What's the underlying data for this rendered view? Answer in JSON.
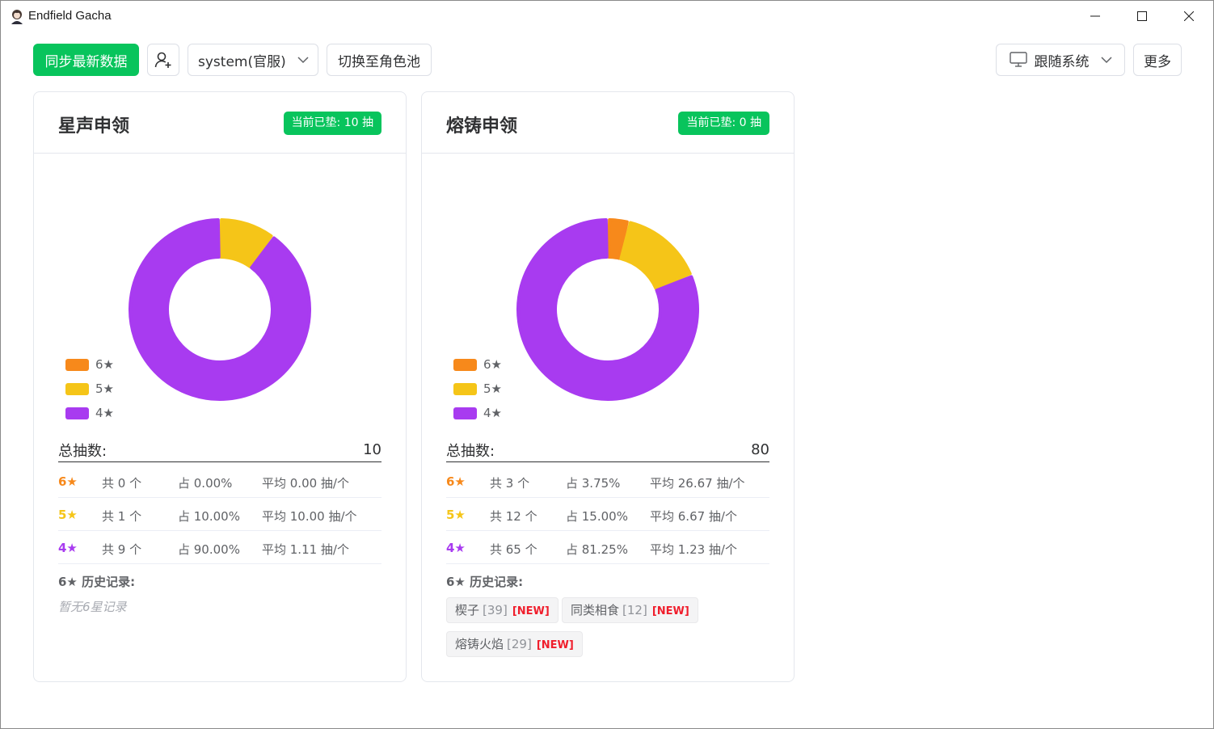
{
  "window": {
    "title": "Endfield Gacha",
    "icon": "avatar-icon",
    "controls": [
      "minimize-icon",
      "maximize-icon",
      "close-icon"
    ]
  },
  "toolbar": {
    "sync_label": "同步最新数据",
    "account_icon": "user-add-icon",
    "server_select": "system(官服)",
    "switch_pool_label": "切换至角色池",
    "theme_icon": "monitor-icon",
    "theme_select": "跟随系统",
    "more_label": "更多"
  },
  "colors": {
    "accent_green": "#08c45c",
    "six_star": "#f7891b",
    "five_star": "#f5c518",
    "four_star": "#a83bf0",
    "new_tag": "#f01e2c"
  },
  "legend": {
    "six": "6★",
    "five": "5★",
    "four": "4★"
  },
  "labels": {
    "total": "总抽数:",
    "history_title": "6★ 历史记录:",
    "new_tag": "[NEW]"
  },
  "cards": [
    {
      "title": "星声申领",
      "pity": "当前已垫: 10 抽",
      "total": "10",
      "stats": [
        {
          "rank": "6★",
          "count": "共 0 个",
          "pct": "占 0.00%",
          "avg": "平均 0.00 抽/个"
        },
        {
          "rank": "5★",
          "count": "共 1 个",
          "pct": "占 10.00%",
          "avg": "平均 10.00 抽/个"
        },
        {
          "rank": "4★",
          "count": "共 9 个",
          "pct": "占 90.00%",
          "avg": "平均 1.11 抽/个"
        }
      ],
      "history_empty": "暂无6星记录",
      "history": []
    },
    {
      "title": "熔铸申领",
      "pity": "当前已垫: 0 抽",
      "total": "80",
      "stats": [
        {
          "rank": "6★",
          "count": "共 3 个",
          "pct": "占 3.75%",
          "avg": "平均 26.67 抽/个"
        },
        {
          "rank": "5★",
          "count": "共 12 个",
          "pct": "占 15.00%",
          "avg": "平均 6.67 抽/个"
        },
        {
          "rank": "4★",
          "count": "共 65 个",
          "pct": "占 81.25%",
          "avg": "平均 1.23 抽/个"
        }
      ],
      "history": [
        {
          "name": "楔子",
          "pity": "[39]"
        },
        {
          "name": "同类相食",
          "pity": "[12]"
        },
        {
          "name": "熔铸火焰",
          "pity": "[29]"
        }
      ]
    }
  ],
  "chart_data": [
    {
      "type": "pie",
      "categories": [
        "6★",
        "5★",
        "4★"
      ],
      "values": [
        0,
        1,
        9
      ],
      "colors": [
        "#f7891b",
        "#f5c518",
        "#a83bf0"
      ],
      "donut": true
    },
    {
      "type": "pie",
      "categories": [
        "6★",
        "5★",
        "4★"
      ],
      "values": [
        3,
        12,
        65
      ],
      "colors": [
        "#f7891b",
        "#f5c518",
        "#a83bf0"
      ],
      "donut": true
    }
  ]
}
